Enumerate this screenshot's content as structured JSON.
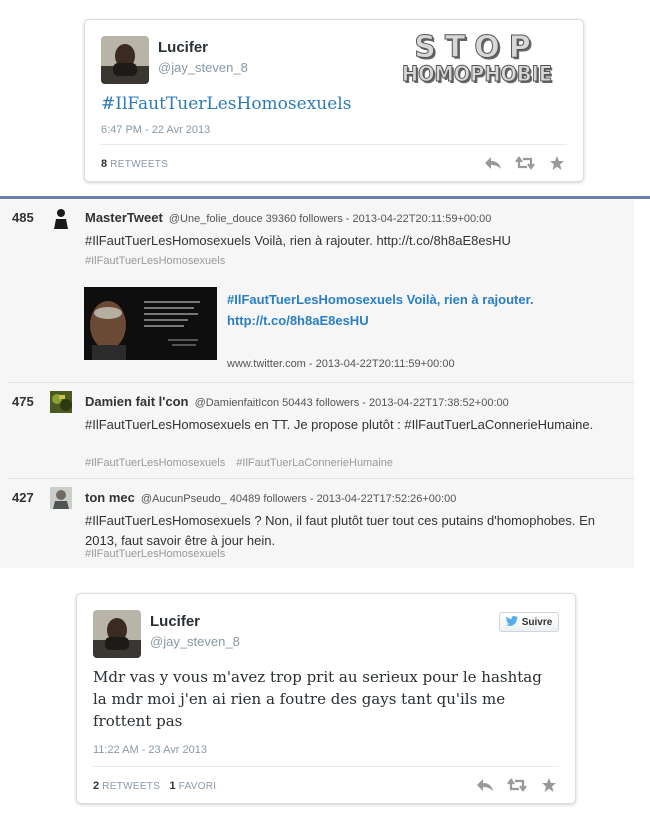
{
  "top_card": {
    "user_name": "Lucifer",
    "user_handle": "@jay_steven_8",
    "logo_line1": "STOP",
    "logo_line2": "HOMOPHOBIE",
    "hashtag": "#IlFautTuerLesHomosexuels",
    "timestamp": "6:47 PM - 22 Avr 2013",
    "retweet_count": "8",
    "retweet_label": "RETWEETS"
  },
  "ranked_list": [
    {
      "rank": "485",
      "name": "MasterTweet",
      "meta": "@Une_folie_douce 39360 followers - 2013-04-22T20:11:59+00:00",
      "text": "#IlFautTuerLesHomosexuels Voilà, rien à rajouter. http://t.co/8h8aE8esHU",
      "tags": [
        "#IlFautTuerLesHomosexuels"
      ],
      "preview_text": "#IlFautTuerLesHomosexuels Voilà, rien à rajouter. http://t.co/8h8aE8esHU",
      "preview_source": "www.twitter.com - 2013-04-22T20:11:59+00:00"
    },
    {
      "rank": "475",
      "name": "Damien fait l'con",
      "meta": "@DamienfaitIcon 50443 followers - 2013-04-22T17:38:52+00:00",
      "text": "#IlFautTuerLesHomosexuels en TT. Je propose plutôt : #IlFautTuerLaConnerieHumaine.",
      "tags": [
        "#IlFautTuerLesHomosexuels",
        "#IlFautTuerLaConnerieHumaine"
      ]
    },
    {
      "rank": "427",
      "name": "ton mec",
      "meta": "@AucunPseudo_ 40489 followers - 2013-04-22T17:52:26+00:00",
      "text": "#IlFautTuerLesHomosexuels ? Non, il faut plutôt tuer tout ces putains d'homophobes. En 2013, faut savoir être à jour hein.",
      "tags": [
        "#IlFautTuerLesHomosexuels"
      ]
    }
  ],
  "bottom_card": {
    "user_name": "Lucifer",
    "user_handle": "@jay_steven_8",
    "follow_label": "Suivre",
    "text": "Mdr vas y vous m'avez trop prit au serieux pour le hashtag la mdr moi j'en ai rien a foutre des gays tant qu'ils me frottent pas",
    "timestamp": "11:22 AM - 23 Avr 2013",
    "retweet_count": "2",
    "retweet_label": "RETWEETS",
    "favorite_count": "1",
    "favorite_label": "FAVORI"
  },
  "colors": {
    "link": "#2b7bb9",
    "separator": "#6b7fa8",
    "muted": "#8899a6",
    "twitter_blue": "#55acee"
  },
  "icons": [
    "reply-icon",
    "retweet-icon",
    "favorite-icon",
    "twitter-bird-icon"
  ]
}
